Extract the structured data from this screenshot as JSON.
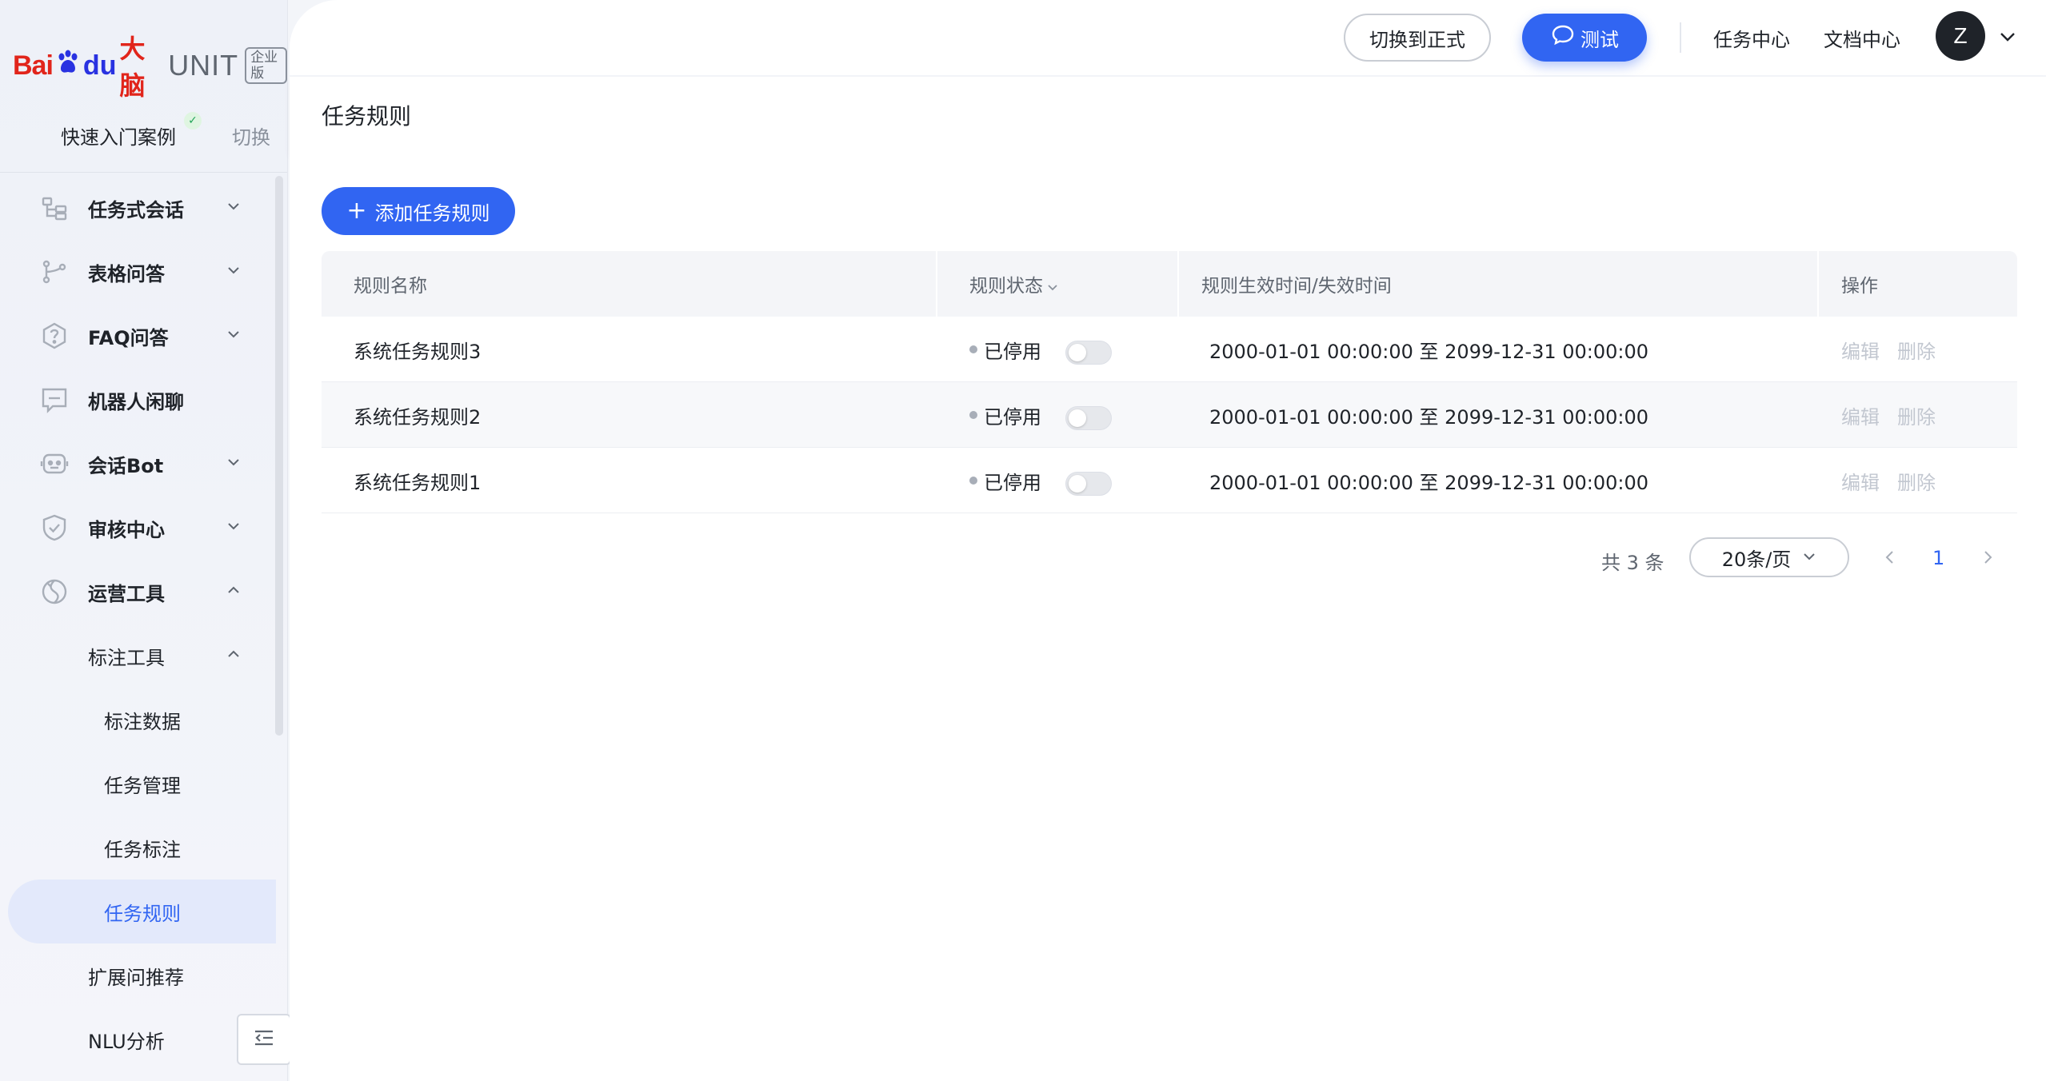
{
  "brand": {
    "logo_bai": "Bai",
    "logo_du": "du",
    "logo_brain": "大脑",
    "product": "UNIT",
    "edition": "企业版"
  },
  "project": {
    "name": "快速入门案例",
    "switch_label": "切换"
  },
  "sidebar": {
    "items": [
      {
        "label": "任务式会话",
        "icon": "tree-icon",
        "expanded": false
      },
      {
        "label": "表格问答",
        "icon": "branch-icon",
        "expanded": false
      },
      {
        "label": "FAQ问答",
        "icon": "question-hexagon-icon",
        "expanded": false
      },
      {
        "label": "机器人闲聊",
        "icon": "chat-box-icon"
      },
      {
        "label": "会话Bot",
        "icon": "bot-icon",
        "expanded": false
      },
      {
        "label": "审核中心",
        "icon": "shield-check-icon",
        "expanded": false
      },
      {
        "label": "运营工具",
        "icon": "tools-icon",
        "expanded": true
      }
    ],
    "sub": {
      "label": "标注工具",
      "expanded": true,
      "leaves": [
        "标注数据",
        "任务管理",
        "任务标注",
        "任务规则"
      ],
      "active": "任务规则"
    },
    "after": [
      "扩展问推荐",
      "NLU分析"
    ]
  },
  "header": {
    "switch_btn": "切换到正式",
    "test_btn": "测试",
    "link_task_center": "任务中心",
    "link_doc_center": "文档中心",
    "avatar_letter": "Z"
  },
  "page": {
    "title": "任务规则",
    "add_btn": "添加任务规则"
  },
  "table": {
    "columns": [
      "规则名称",
      "规则状态",
      "规则生效时间/失效时间",
      "操作"
    ],
    "rows": [
      {
        "name": "系统任务规则3",
        "status": "已停用",
        "enabled": false,
        "time": "2000-01-01 00:00:00 至 2099-12-31 00:00:00",
        "edit": "编辑",
        "delete": "删除"
      },
      {
        "name": "系统任务规则2",
        "status": "已停用",
        "enabled": false,
        "time": "2000-01-01 00:00:00 至 2099-12-31 00:00:00",
        "edit": "编辑",
        "delete": "删除"
      },
      {
        "name": "系统任务规则1",
        "status": "已停用",
        "enabled": false,
        "time": "2000-01-01 00:00:00 至 2099-12-31 00:00:00",
        "edit": "编辑",
        "delete": "删除"
      }
    ]
  },
  "pagination": {
    "total": "共 3 条",
    "page_size": "20条/页",
    "current_page": "1"
  },
  "colors": {
    "accent": "#3165f2",
    "brand_red": "#e1251b",
    "brand_blue": "#2932e1"
  }
}
